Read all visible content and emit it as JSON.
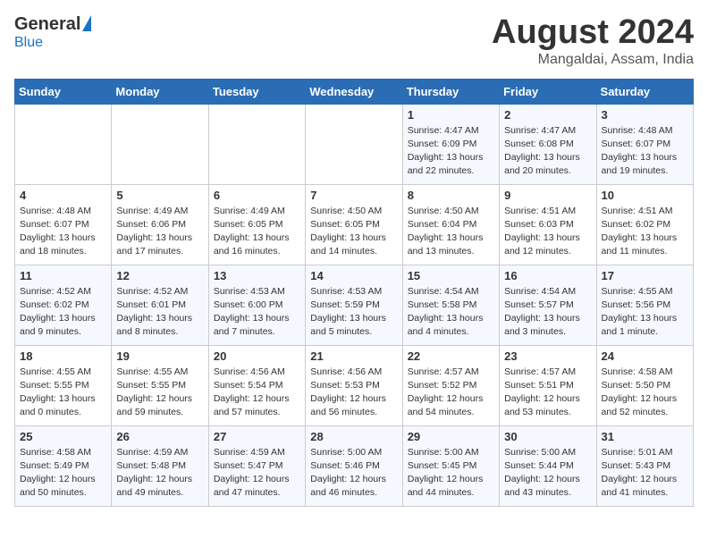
{
  "header": {
    "logo_general": "General",
    "logo_blue": "Blue",
    "month_title": "August 2024",
    "location": "Mangaldai, Assam, India"
  },
  "weekdays": [
    "Sunday",
    "Monday",
    "Tuesday",
    "Wednesday",
    "Thursday",
    "Friday",
    "Saturday"
  ],
  "weeks": [
    [
      {
        "day": "",
        "info": ""
      },
      {
        "day": "",
        "info": ""
      },
      {
        "day": "",
        "info": ""
      },
      {
        "day": "",
        "info": ""
      },
      {
        "day": "1",
        "info": "Sunrise: 4:47 AM\nSunset: 6:09 PM\nDaylight: 13 hours\nand 22 minutes."
      },
      {
        "day": "2",
        "info": "Sunrise: 4:47 AM\nSunset: 6:08 PM\nDaylight: 13 hours\nand 20 minutes."
      },
      {
        "day": "3",
        "info": "Sunrise: 4:48 AM\nSunset: 6:07 PM\nDaylight: 13 hours\nand 19 minutes."
      }
    ],
    [
      {
        "day": "4",
        "info": "Sunrise: 4:48 AM\nSunset: 6:07 PM\nDaylight: 13 hours\nand 18 minutes."
      },
      {
        "day": "5",
        "info": "Sunrise: 4:49 AM\nSunset: 6:06 PM\nDaylight: 13 hours\nand 17 minutes."
      },
      {
        "day": "6",
        "info": "Sunrise: 4:49 AM\nSunset: 6:05 PM\nDaylight: 13 hours\nand 16 minutes."
      },
      {
        "day": "7",
        "info": "Sunrise: 4:50 AM\nSunset: 6:05 PM\nDaylight: 13 hours\nand 14 minutes."
      },
      {
        "day": "8",
        "info": "Sunrise: 4:50 AM\nSunset: 6:04 PM\nDaylight: 13 hours\nand 13 minutes."
      },
      {
        "day": "9",
        "info": "Sunrise: 4:51 AM\nSunset: 6:03 PM\nDaylight: 13 hours\nand 12 minutes."
      },
      {
        "day": "10",
        "info": "Sunrise: 4:51 AM\nSunset: 6:02 PM\nDaylight: 13 hours\nand 11 minutes."
      }
    ],
    [
      {
        "day": "11",
        "info": "Sunrise: 4:52 AM\nSunset: 6:02 PM\nDaylight: 13 hours\nand 9 minutes."
      },
      {
        "day": "12",
        "info": "Sunrise: 4:52 AM\nSunset: 6:01 PM\nDaylight: 13 hours\nand 8 minutes."
      },
      {
        "day": "13",
        "info": "Sunrise: 4:53 AM\nSunset: 6:00 PM\nDaylight: 13 hours\nand 7 minutes."
      },
      {
        "day": "14",
        "info": "Sunrise: 4:53 AM\nSunset: 5:59 PM\nDaylight: 13 hours\nand 5 minutes."
      },
      {
        "day": "15",
        "info": "Sunrise: 4:54 AM\nSunset: 5:58 PM\nDaylight: 13 hours\nand 4 minutes."
      },
      {
        "day": "16",
        "info": "Sunrise: 4:54 AM\nSunset: 5:57 PM\nDaylight: 13 hours\nand 3 minutes."
      },
      {
        "day": "17",
        "info": "Sunrise: 4:55 AM\nSunset: 5:56 PM\nDaylight: 13 hours\nand 1 minute."
      }
    ],
    [
      {
        "day": "18",
        "info": "Sunrise: 4:55 AM\nSunset: 5:55 PM\nDaylight: 13 hours\nand 0 minutes."
      },
      {
        "day": "19",
        "info": "Sunrise: 4:55 AM\nSunset: 5:55 PM\nDaylight: 12 hours\nand 59 minutes."
      },
      {
        "day": "20",
        "info": "Sunrise: 4:56 AM\nSunset: 5:54 PM\nDaylight: 12 hours\nand 57 minutes."
      },
      {
        "day": "21",
        "info": "Sunrise: 4:56 AM\nSunset: 5:53 PM\nDaylight: 12 hours\nand 56 minutes."
      },
      {
        "day": "22",
        "info": "Sunrise: 4:57 AM\nSunset: 5:52 PM\nDaylight: 12 hours\nand 54 minutes."
      },
      {
        "day": "23",
        "info": "Sunrise: 4:57 AM\nSunset: 5:51 PM\nDaylight: 12 hours\nand 53 minutes."
      },
      {
        "day": "24",
        "info": "Sunrise: 4:58 AM\nSunset: 5:50 PM\nDaylight: 12 hours\nand 52 minutes."
      }
    ],
    [
      {
        "day": "25",
        "info": "Sunrise: 4:58 AM\nSunset: 5:49 PM\nDaylight: 12 hours\nand 50 minutes."
      },
      {
        "day": "26",
        "info": "Sunrise: 4:59 AM\nSunset: 5:48 PM\nDaylight: 12 hours\nand 49 minutes."
      },
      {
        "day": "27",
        "info": "Sunrise: 4:59 AM\nSunset: 5:47 PM\nDaylight: 12 hours\nand 47 minutes."
      },
      {
        "day": "28",
        "info": "Sunrise: 5:00 AM\nSunset: 5:46 PM\nDaylight: 12 hours\nand 46 minutes."
      },
      {
        "day": "29",
        "info": "Sunrise: 5:00 AM\nSunset: 5:45 PM\nDaylight: 12 hours\nand 44 minutes."
      },
      {
        "day": "30",
        "info": "Sunrise: 5:00 AM\nSunset: 5:44 PM\nDaylight: 12 hours\nand 43 minutes."
      },
      {
        "day": "31",
        "info": "Sunrise: 5:01 AM\nSunset: 5:43 PM\nDaylight: 12 hours\nand 41 minutes."
      }
    ]
  ]
}
